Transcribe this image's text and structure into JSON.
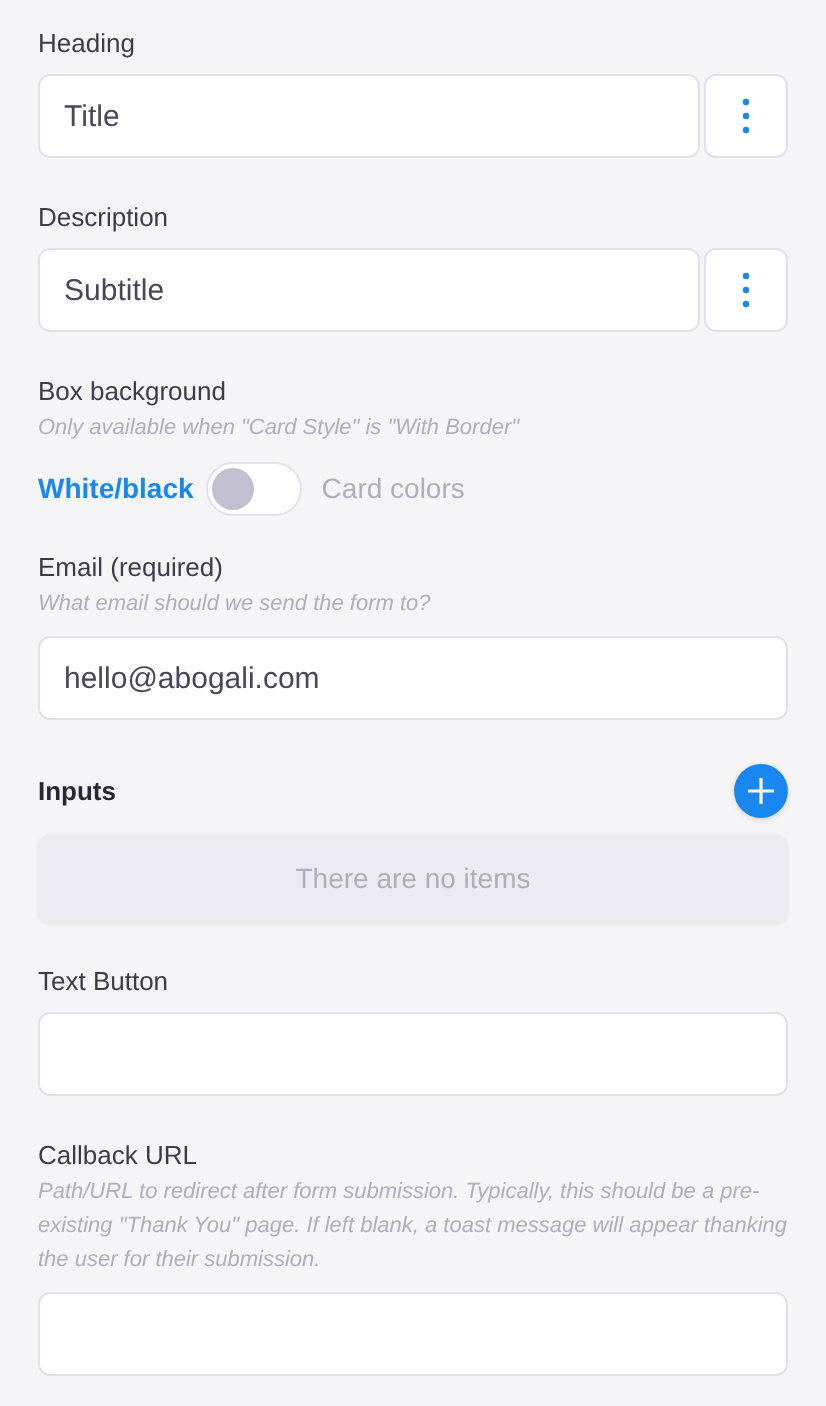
{
  "fields": [
    {
      "kind": "text_with_menu",
      "label": "Heading",
      "value": "Title"
    },
    {
      "kind": "text_with_menu",
      "label": "Description",
      "value": "Subtitle"
    },
    {
      "kind": "toggle",
      "label": "Box background",
      "hint": "Only available when \"Card Style\" is \"With Border\"",
      "left_label": "White/black",
      "right_label": "Card colors",
      "on": false
    },
    {
      "kind": "text",
      "label": "Email (required)",
      "hint": "What email should we send the form to?",
      "value": "hello@abogali.com"
    },
    {
      "kind": "list",
      "label": "Inputs",
      "empty_text": "There are no items"
    },
    {
      "kind": "text",
      "label": "Text Button"
    },
    {
      "kind": "text",
      "label": "Callback URL",
      "hint": "Path/URL to redirect after form submission. Typically, this should be a pre-existing \"Thank You\" page. If left blank, a toast message will appear thanking the user for their submission."
    }
  ]
}
